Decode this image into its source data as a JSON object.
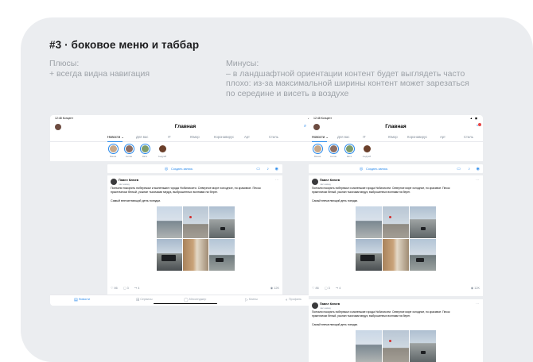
{
  "slide": {
    "title": "#3 · боковое меню и таббар",
    "pros_heading": "Плюсы:",
    "pros_item": "+ всегда видна навигация",
    "cons_heading": "Минусы:",
    "cons_line1": "– в ландшафтной ориентации контент будет выглядеть часто",
    "cons_line2": "плохо: из-за максимальной ширины контент может зарезаться",
    "cons_line3": "по середине и висеть в воздухе"
  },
  "status": {
    "time": "12:48  Концепт",
    "indicators": "▲ ◼"
  },
  "navbar": {
    "title": "Главная"
  },
  "tabs": [
    "Новости ⌄",
    "Для вас",
    "IT",
    "Юмор",
    "Коронавирус",
    "Арт",
    "Стиль"
  ],
  "stories": [
    "Маша",
    "Антон",
    "Катя",
    "Андрей"
  ],
  "composer": {
    "label": "Создать запись"
  },
  "post": {
    "author": "Павел Клюев",
    "time": "час назад",
    "line1": "Поехали покорять побережье и маленькие города Нобилисити. Северное море холодное, но красивое. Песок",
    "line2": "практически белый, усыпан тысячами медуз, выброшенных волнами на берег.",
    "line3": "Самый впечатляющий день поездки.",
    "likes": "86",
    "comments": "3",
    "shares": "4",
    "views": "12K"
  },
  "tabbar": {
    "items": [
      "Новости",
      "Сервисы",
      "Мессенджер",
      "Клипы",
      "Профиль"
    ]
  },
  "colors": {
    "accent": "#2688eb",
    "card_bg": "#ebedf0",
    "badge": "#e64646"
  }
}
